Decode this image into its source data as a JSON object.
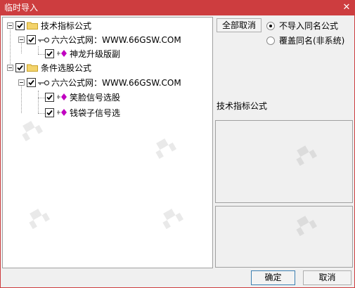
{
  "window": {
    "title": "临时导入",
    "close_glyph": "✕"
  },
  "tree": {
    "groups": [
      {
        "label": "技术指标公式",
        "source": "六六公式网：WWW.66GSW.COM",
        "items": [
          "神龙升级版副"
        ]
      },
      {
        "label": "条件选股公式",
        "source": "六六公式网：WWW.66GSW.COM",
        "items": [
          "笑脸信号选股",
          "钱袋子信号选"
        ]
      }
    ]
  },
  "controls": {
    "deselect_all": "全部取消",
    "radio_no_import": "不导入同名公式",
    "radio_overwrite": "覆盖同名(非系统)",
    "selected_radio": "no_import"
  },
  "detail": {
    "label": "技术指标公式"
  },
  "footer": {
    "ok": "确定",
    "cancel": "取消"
  },
  "colors": {
    "titlebar": "#cd3d3f",
    "formula_icon": "#c000c0",
    "folder": "#f0c040"
  }
}
